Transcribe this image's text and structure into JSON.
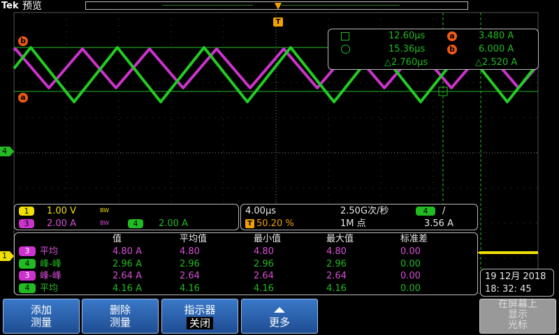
{
  "header": {
    "brand": "Tek",
    "mode": "预览",
    "trigger_marker": "T"
  },
  "colors": {
    "ch1": "#f0e000",
    "ch3": "#d94fd9",
    "ch4": "#22bb22",
    "cursor": "#f05a14"
  },
  "markers": {
    "cursor_b": "b",
    "cursor_a": "a",
    "ch4_level": "4",
    "ch1_level": "1"
  },
  "cursor_readout": {
    "row1": {
      "time": "12.60µs",
      "label": "a",
      "value": "3.480 A"
    },
    "row2": {
      "time": "15.36µs",
      "label": "b",
      "value": "6.000 A"
    },
    "delta": {
      "time": "△2.760µs",
      "value": "△2.520 A"
    }
  },
  "channels": {
    "ch1": {
      "num": "1",
      "scale": "1.00 V",
      "bw": "BW"
    },
    "ch3": {
      "num": "3",
      "scale": "2.00 A",
      "bw": "BW"
    },
    "ch4": {
      "num": "4",
      "scale": "2.00 A"
    }
  },
  "horizontal": {
    "timebase": "4.00µs",
    "sample_rate": "2.50G次/秒",
    "record": "1M 点",
    "trig_pos": "50.20 %",
    "trig_ch": "4",
    "trig_level": "3.56 A",
    "trig_slope": "/"
  },
  "measurements": {
    "headers": [
      "值",
      "平均值",
      "最小值",
      "最大值",
      "标准差"
    ],
    "rows": [
      {
        "ch": "3",
        "name": "平均",
        "value": "4.80 A",
        "mean": "4.80",
        "min": "4.80",
        "max": "4.80",
        "std": "0.00"
      },
      {
        "ch": "4",
        "name": "峰-峰",
        "value": "2.96 A",
        "mean": "2.96",
        "min": "2.96",
        "max": "2.96",
        "std": "0.00"
      },
      {
        "ch": "3",
        "name": "峰-峰",
        "value": "2.64 A",
        "mean": "2.64",
        "min": "2.64",
        "max": "2.64",
        "std": "0.00"
      },
      {
        "ch": "4",
        "name": "平均",
        "value": "4.16 A",
        "mean": "4.16",
        "min": "4.16",
        "max": "4.16",
        "std": "0.00"
      }
    ]
  },
  "datetime": {
    "date": "19 12月  2018",
    "time": "18: 32: 45"
  },
  "softkeys": {
    "add": {
      "line1": "添加",
      "line2": "测量"
    },
    "remove": {
      "line1": "删除",
      "line2": "测量"
    },
    "indicator": {
      "line1": "指示器",
      "line2": "关闭"
    },
    "more": {
      "label": "更多"
    },
    "cursor_on_screen": {
      "line1": "在屏幕上",
      "line2": "显示",
      "line3": "光标"
    }
  }
}
